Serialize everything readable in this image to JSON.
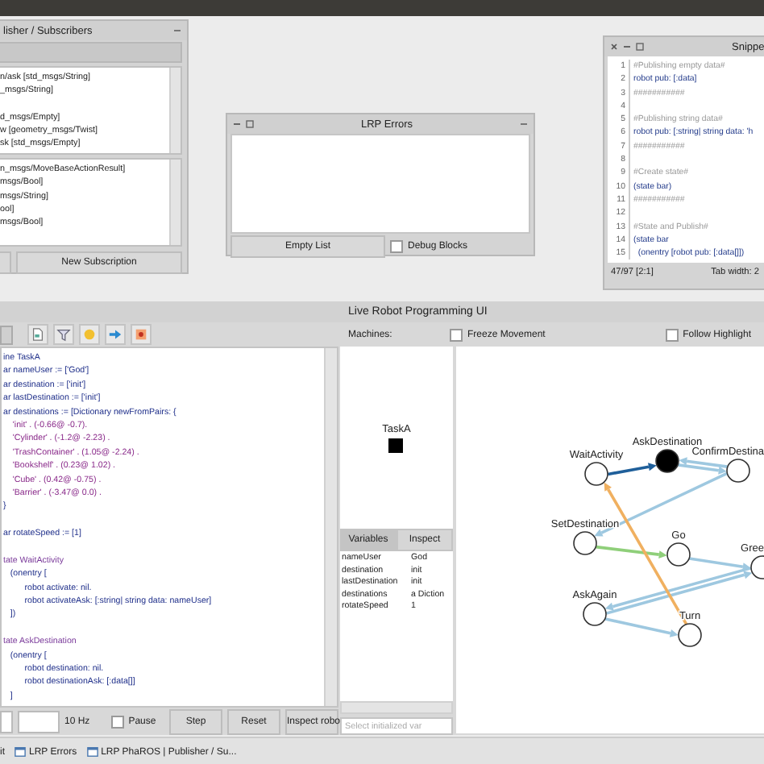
{
  "publisher_window": {
    "title": "lisher / Subscribers",
    "publications": [
      "n/ask [std_msgs/String]",
      "_msgs/String]",
      "d_msgs/Empty]",
      "w [geometry_msgs/Twist]",
      "sk [std_msgs/Empty]"
    ],
    "subscriptions": [
      "n_msgs/MoveBaseActionResult]",
      "msgs/Bool]",
      "msgs/String]",
      "ool]",
      "msgs/Bool]"
    ],
    "button": "New Subscription"
  },
  "errors_window": {
    "title": "LRP Errors",
    "button": "Empty List",
    "debug_blocks": {
      "label": "Debug Blocks",
      "checked": false
    }
  },
  "snippet_window": {
    "title": "Snippe",
    "lines": [
      {
        "number": "1",
        "text": "#Publishing empty data#",
        "kind": "comment"
      },
      {
        "number": "2",
        "text": "robot pub: [:data]",
        "kind": "code"
      },
      {
        "number": "3",
        "text": "###########",
        "kind": "comment"
      },
      {
        "number": "4",
        "kind": "blank"
      },
      {
        "number": "5",
        "text": "#Publishing string data#",
        "kind": "comment"
      },
      {
        "number": "6",
        "text": "robot pub: [:string| string data: 'h",
        "kind": "code"
      },
      {
        "number": "7",
        "text": "###########",
        "kind": "comment"
      },
      {
        "number": "8",
        "kind": "blank"
      },
      {
        "number": "9",
        "text": "#Create state#",
        "kind": "comment"
      },
      {
        "number": "10",
        "text": "(state bar)",
        "kind": "code"
      },
      {
        "number": "11",
        "text": "###########",
        "kind": "comment"
      },
      {
        "number": "12",
        "kind": "blank"
      },
      {
        "number": "13",
        "text": "#State and Publish#",
        "kind": "comment"
      },
      {
        "number": "14",
        "text": "(state bar",
        "kind": "code"
      },
      {
        "number": "15",
        "text": "  (onentry [robot pub: [:data[]])",
        "kind": "code"
      }
    ],
    "position": "47/97 [2:1]",
    "tab_width": "Tab width: 2"
  },
  "lrp_window": {
    "title": "Live Robot Programming UI",
    "machines_label": "Machines:",
    "freeze_movement": {
      "label": "Freeze Movement",
      "checked": false
    },
    "follow_highlight": {
      "label": "Follow Highlight",
      "checked": false
    },
    "code": [
      {
        "text": "ine TaskA",
        "kind": "code"
      },
      {
        "text": "ar nameUser := ['God']",
        "kind": "code"
      },
      {
        "text": "ar destination := ['init']",
        "kind": "code"
      },
      {
        "text": "ar lastDestination := ['init']",
        "kind": "code"
      },
      {
        "text": "ar destinations := [Dictionary newFromPairs: {",
        "kind": "code"
      },
      {
        "text": "    'init' . (-0.66@ -0.7).",
        "kind": "literal"
      },
      {
        "text": "    'Cylinder' . (-1.2@ -2.23) .",
        "kind": "literal"
      },
      {
        "text": "    'TrashContainer' . (1.05@ -2.24) .",
        "kind": "literal"
      },
      {
        "text": "    'Bookshelf' . (0.23@ 1.02) .",
        "kind": "literal"
      },
      {
        "text": "    'Cube' . (0.42@ -0.75) .",
        "kind": "literal"
      },
      {
        "text": "    'Barrier' . (-3.47@ 0.0) .",
        "kind": "literal"
      },
      {
        "text": "}",
        "kind": "code"
      },
      {
        "kind": "blank"
      },
      {
        "text": "ar rotateSpeed := [1]",
        "kind": "code"
      },
      {
        "kind": "blank"
      },
      {
        "text": "tate WaitActivity",
        "kind": "state"
      },
      {
        "text": "   (onentry [",
        "kind": "code"
      },
      {
        "text": "         robot activate: nil.",
        "kind": "code"
      },
      {
        "text": "         robot activateAsk: [:string| string data: nameUser]",
        "kind": "code"
      },
      {
        "text": "   ])",
        "kind": "code"
      },
      {
        "kind": "blank"
      },
      {
        "text": "tate AskDestination",
        "kind": "state"
      },
      {
        "text": "   (onentry [",
        "kind": "code"
      },
      {
        "text": "         robot destination: nil.",
        "kind": "code"
      },
      {
        "text": "         robot destinationAsk: [:data[]]",
        "kind": "code"
      },
      {
        "text": "   ]",
        "kind": "code"
      }
    ],
    "rate": "10 Hz",
    "pause": {
      "label": "Pause",
      "checked": false
    },
    "buttons": [
      "Step",
      "Reset",
      "Inspect robo"
    ],
    "machines": [
      {
        "name": "TaskA",
        "active": true
      }
    ],
    "tabs": [
      {
        "label": "Variables",
        "selected": true
      },
      {
        "label": "Inspect",
        "selected": false
      }
    ],
    "variables": [
      {
        "name": "nameUser",
        "value": "God"
      },
      {
        "name": "destination",
        "value": "init"
      },
      {
        "name": "lastDestination",
        "value": "init"
      },
      {
        "name": "destinations",
        "value": "a Diction"
      },
      {
        "name": "rotateSpeed",
        "value": "1"
      }
    ],
    "var_field": {
      "placeholder": "Select initialized var"
    },
    "states": [
      {
        "name": "WaitActivity",
        "active": false
      },
      {
        "name": "AskDestination",
        "active": true
      },
      {
        "name": "ConfirmDestina",
        "active": false
      },
      {
        "name": "SetDestination",
        "active": false
      },
      {
        "name": "Go",
        "active": false
      },
      {
        "name": "Gree",
        "active": false
      },
      {
        "name": "AskAgain",
        "active": false
      },
      {
        "name": "Turn",
        "active": false
      }
    ],
    "transitions": [
      {
        "color": "#1f5f9a"
      },
      {
        "color": "#9ec8e0"
      },
      {
        "color": "#9ec8e0"
      },
      {
        "color": "#9ec8e0"
      },
      {
        "color": "#8fcf7a"
      },
      {
        "color": "#9ec8e0"
      },
      {
        "color": "#9ec8e0"
      },
      {
        "color": "#9ec8e0"
      },
      {
        "color": "#9ec8e0"
      },
      {
        "color": "#f0b060"
      }
    ]
  },
  "taskbar": [
    {
      "label": "it",
      "icon": false
    },
    {
      "label": "LRP Errors",
      "icon": true
    },
    {
      "label": "LRP PhaROS | Publisher / Su...",
      "icon": true
    }
  ]
}
